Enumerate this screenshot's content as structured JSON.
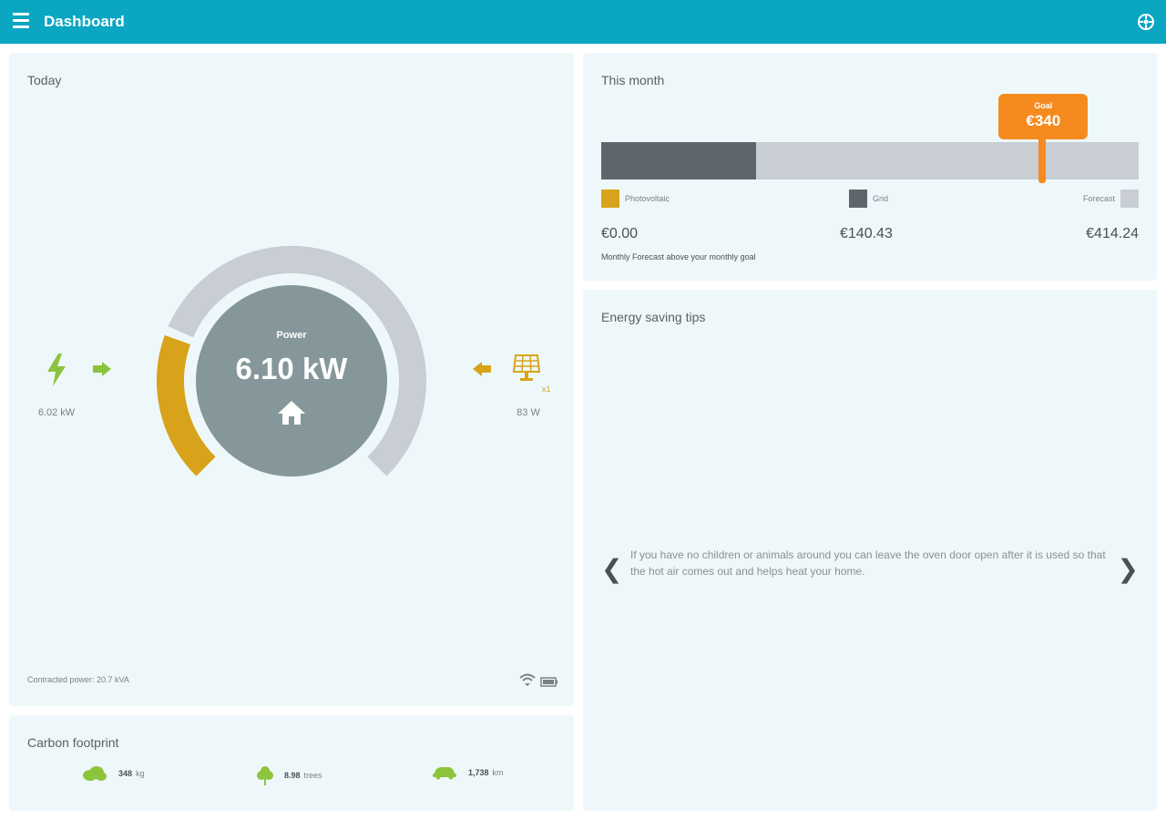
{
  "header": {
    "title": "Dashboard",
    "menu_icon": "hamburger-menu-icon",
    "settings_icon": "settings-icon"
  },
  "today": {
    "title": "Today",
    "power_label": "Power",
    "power_value": "6.10 kW",
    "grid_value": "6.02 kW",
    "solar_value": "83 W",
    "solar_multiplier": "x1",
    "contracted": "Contracted power: 20.7 kVA",
    "colors": {
      "solar": "#d8a31a",
      "remaining": "#c8ced3",
      "center": "#85979a",
      "grid_icon": "#8cc43c"
    },
    "gauge_solar_fraction": 0.24
  },
  "month": {
    "title": "This month",
    "goal_label": "Goal",
    "goal_value": "€340",
    "legend": {
      "pv": "Photovoltaic",
      "grid": "Grid",
      "forecast": "Forecast"
    },
    "amounts": {
      "pv": "€0.00",
      "grid": "€140.43",
      "forecast": "€414.24"
    },
    "note": "Monthly Forecast above your monthly goal",
    "bar_max": 414.24,
    "goal_amount": 340,
    "grid_amount": 140.43,
    "colors": {
      "pv": "#d8a31a",
      "grid": "#5d666b",
      "forecast": "#c8ced3",
      "goal": "#f58b1f"
    }
  },
  "tips": {
    "title": "Energy saving tips",
    "text": "If you have no children or animals around you can leave the oven door open after it is used so that the hot air comes out and helps heat your home.",
    "prev": "❮",
    "next": "❯"
  },
  "carbon": {
    "title": "Carbon footprint",
    "items": [
      {
        "icon": "cloud-co2-icon",
        "value": "348",
        "unit": "kg"
      },
      {
        "icon": "tree-icon",
        "value": "8.98",
        "unit": "trees"
      },
      {
        "icon": "car-icon",
        "value": "1,738",
        "unit": "km"
      }
    ]
  }
}
